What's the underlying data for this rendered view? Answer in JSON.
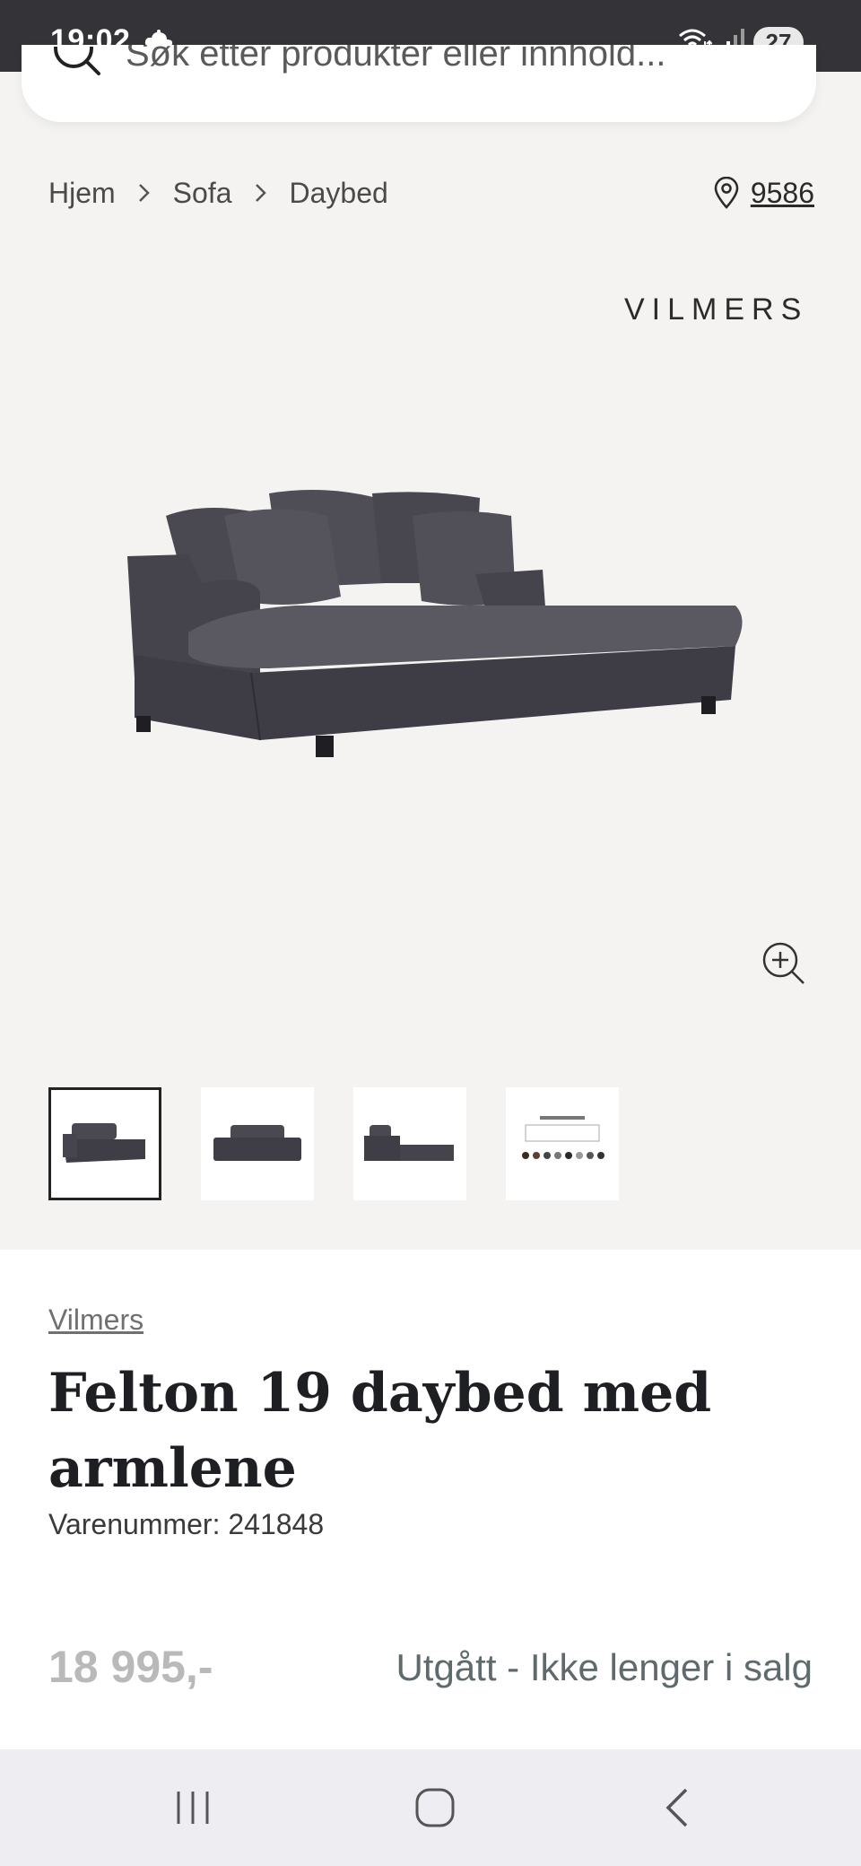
{
  "status_bar": {
    "time": "19:02",
    "battery": "27",
    "icons": [
      "cloud-icon",
      "wifi-icon",
      "signal-icon",
      "battery-icon"
    ]
  },
  "search": {
    "placeholder": "Søk etter produkter eller innhold..."
  },
  "breadcrumb": {
    "items": [
      "Hjem",
      "Sofa",
      "Daybed"
    ]
  },
  "store": {
    "number": "9586"
  },
  "gallery": {
    "brand_logo": "VILMERS",
    "thumbnail_count": 4,
    "selected_index": 0
  },
  "product": {
    "brand": "Vilmers",
    "title": "Felton 19 daybed med armlene",
    "sku_label": "Varenummer:",
    "sku_value": "241848",
    "price": "18 995,-",
    "availability": "Utgått - Ikke lenger i salg"
  },
  "colors": {
    "status_bar_bg": "#333338",
    "page_bg": "#f4f3f1",
    "title": "#1d1f23",
    "price_muted": "#b9b9b9",
    "availability": "#5f6a6c"
  }
}
